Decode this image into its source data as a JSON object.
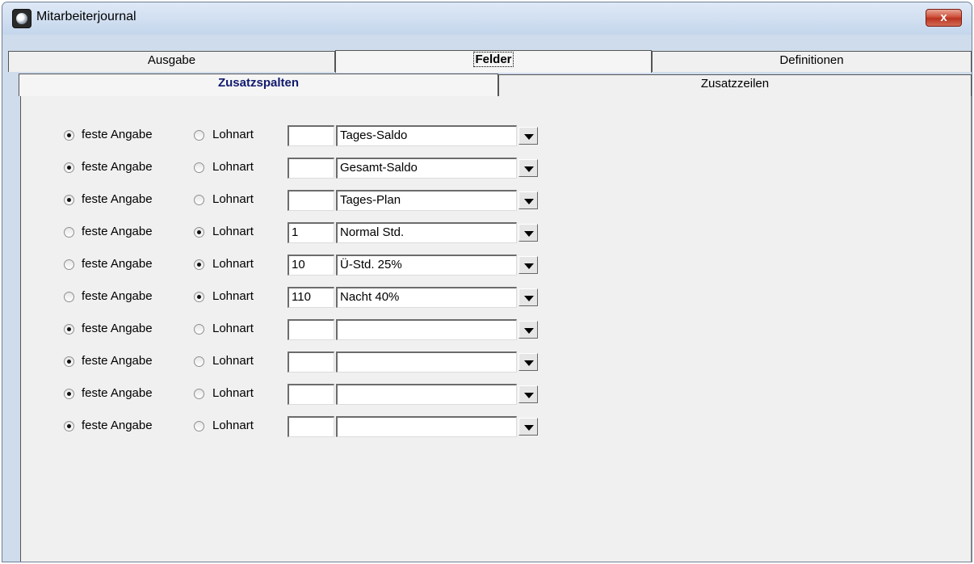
{
  "window": {
    "title": "Mitarbeiterjournal",
    "close_symbol": "x"
  },
  "tabs": {
    "main": [
      "Ausgabe",
      "Felder",
      "Definitionen"
    ],
    "active_main": "Felder"
  },
  "subtabs": {
    "items": [
      "Zusatzspalten",
      "Zusatzzeilen"
    ],
    "active": "Zusatzspalten"
  },
  "labels": {
    "fixed": "feste Angabe",
    "wage": "Lohnart"
  },
  "rows": [
    {
      "selected": "fixed",
      "code": "",
      "value": "Tages-Saldo"
    },
    {
      "selected": "fixed",
      "code": "",
      "value": "Gesamt-Saldo"
    },
    {
      "selected": "fixed",
      "code": "",
      "value": "Tages-Plan"
    },
    {
      "selected": "wage",
      "code": "1",
      "value": "Normal Std."
    },
    {
      "selected": "wage",
      "code": "10",
      "value": "Ü-Std. 25%"
    },
    {
      "selected": "wage",
      "code": "110",
      "value": "Nacht 40%"
    },
    {
      "selected": "fixed",
      "code": "",
      "value": ""
    },
    {
      "selected": "fixed",
      "code": "",
      "value": ""
    },
    {
      "selected": "fixed",
      "code": "",
      "value": ""
    },
    {
      "selected": "fixed",
      "code": "",
      "value": ""
    }
  ],
  "icons": {
    "app": "app-icon",
    "close": "close-icon",
    "dropdown": "dropdown-arrow-icon"
  }
}
